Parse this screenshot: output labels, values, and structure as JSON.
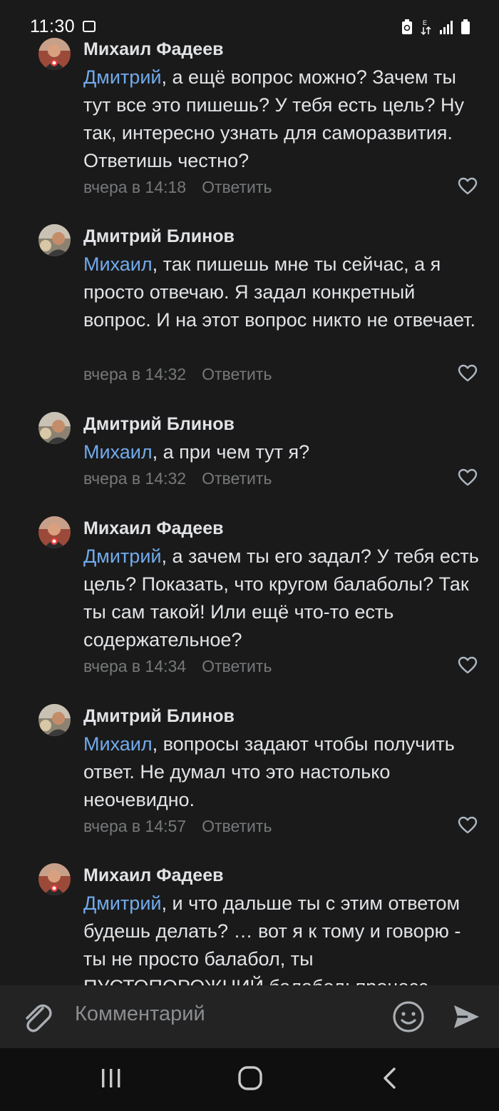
{
  "status_bar": {
    "time": "11:30"
  },
  "comments": [
    {
      "author": "Михаил Фадеев",
      "avatar": "avatar-mikhail",
      "mention": "Дмитрий",
      "text": ", а ещё вопрос можно? Зачем ты тут все это пишешь? У тебя есть цель? Ну так, интересно узнать для саморазвития. Ответишь честно?",
      "time": "вчера в 14:18",
      "reply": "Ответить"
    },
    {
      "author": "Дмитрий Блинов",
      "avatar": "avatar-dmitry",
      "mention": "Михаил",
      "text": ", так пишешь мне ты сейчас, а я просто отвечаю. Я задал конкретный вопрос. И на этот вопрос никто не отвечает.",
      "time": "вчера в 14:32",
      "reply": "Ответить"
    },
    {
      "author": "Дмитрий Блинов",
      "avatar": "avatar-dmitry",
      "mention": "Михаил",
      "text": ", а при чем тут я?",
      "time": "вчера в 14:32",
      "reply": "Ответить"
    },
    {
      "author": "Михаил Фадеев",
      "avatar": "avatar-mikhail",
      "mention": "Дмитрий",
      "text": ", а зачем ты его задал? У тебя есть цель? Показать, что кругом балаболы? Так ты сам такой! Или ещё что-то есть содержательное?",
      "time": "вчера в 14:34",
      "reply": "Ответить"
    },
    {
      "author": "Дмитрий Блинов",
      "avatar": "avatar-dmitry",
      "mention": "Михаил",
      "text": ", вопросы задают чтобы получить ответ. Не думал что это настолько неочевидно.",
      "time": "вчера в 14:57",
      "reply": "Ответить"
    },
    {
      "author": "Михаил Фадеев",
      "avatar": "avatar-mikhail",
      "mention": "Дмитрий",
      "text": ", и что дальше ты с этим ответом будешь делать? … вот я к тому и говорю - ты не просто балабол, ты ПУСТОПОРОЖНИЙ балабол: процесс",
      "time": "",
      "reply": ""
    }
  ],
  "composer": {
    "placeholder": "Комментарий"
  },
  "colors": {
    "background": "#1a1a1a",
    "text": "#e1e3e6",
    "mention": "#71aaeb",
    "meta": "#76787a",
    "composer_bg": "#232323",
    "navbar_bg": "#0f0f0f"
  },
  "icons": {
    "attach": "paperclip-icon",
    "emoji": "smile-icon",
    "send": "send-icon",
    "like": "heart-icon"
  }
}
